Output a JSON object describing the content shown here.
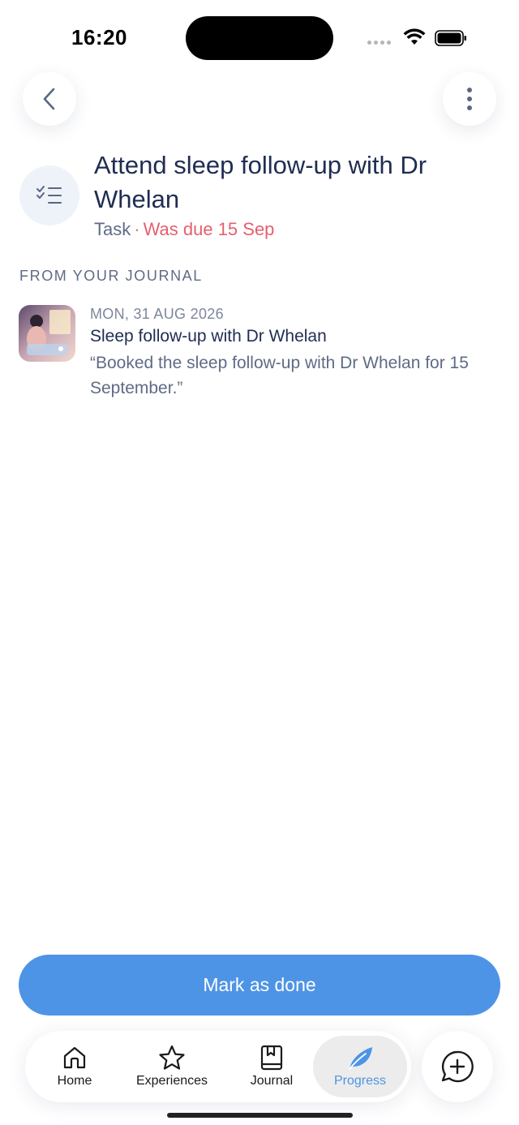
{
  "status_bar": {
    "time": "16:20"
  },
  "header": {
    "back_icon": "chevron-left-icon",
    "more_icon": "more-vertical-icon"
  },
  "task": {
    "icon": "checklist-icon",
    "title": "Attend sleep follow-up with Dr Whelan",
    "type": "Task",
    "separator": "·",
    "due_text": "Was due 15 Sep",
    "due_color": "#e65f6e"
  },
  "journal_section": {
    "label": "FROM YOUR JOURNAL",
    "entry": {
      "date": "MON, 31 AUG 2026",
      "title": "Sleep follow-up with Dr Whelan",
      "quote": "“Booked the sleep follow-up with Dr Whelan for 15 September.”"
    }
  },
  "primary_action": {
    "label": "Mark as done",
    "color": "#4d94e6"
  },
  "tab_bar": {
    "tabs": [
      {
        "label": "Home",
        "icon": "home-icon"
      },
      {
        "label": "Experiences",
        "icon": "star-icon"
      },
      {
        "label": "Journal",
        "icon": "journal-icon"
      },
      {
        "label": "Progress",
        "icon": "leaf-icon",
        "active": true
      }
    ],
    "compose_icon": "chat-plus-icon",
    "active_color": "#4d94e6"
  }
}
